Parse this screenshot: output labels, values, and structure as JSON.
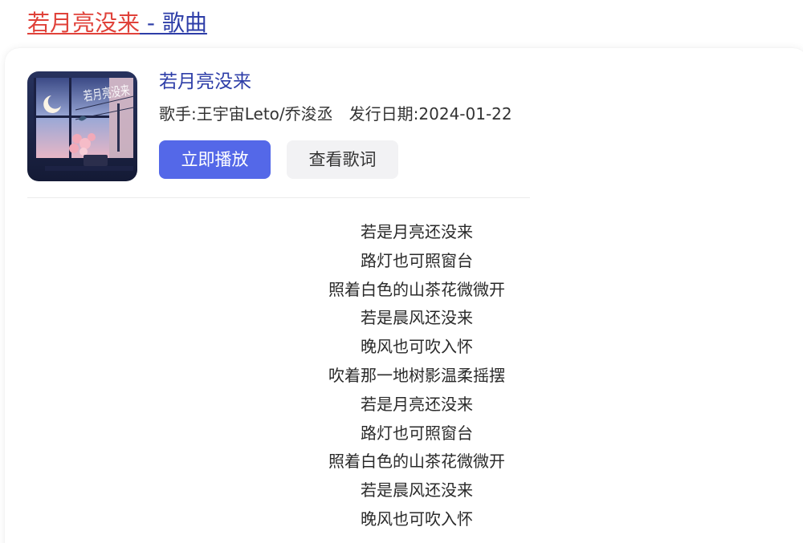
{
  "header": {
    "title_highlight": "若月亮没来",
    "title_suffix": " - 歌曲"
  },
  "song": {
    "name": "若月亮没来",
    "artist_label": "歌手:王宇宙Leto/乔浚丞",
    "release_label": "发行日期:2024-01-22",
    "cover_text": "若月亮没来"
  },
  "actions": {
    "play_label": "立即播放",
    "lyrics_label": "查看歌词"
  },
  "lyrics": [
    "若是月亮还没来",
    "路灯也可照窗台",
    "照着白色的山茶花微微开",
    "若是晨风还没来",
    "晚风也可吹入怀",
    "吹着那一地树影温柔摇摆",
    "若是月亮还没来",
    "路灯也可照窗台",
    "照着白色的山茶花微微开",
    "若是晨风还没来",
    "晚风也可吹入怀"
  ],
  "colors": {
    "title_highlight": "#e0423a",
    "link_blue": "#2e3ea8",
    "play_button": "#5468e8",
    "secondary_button": "#f2f2f4"
  }
}
